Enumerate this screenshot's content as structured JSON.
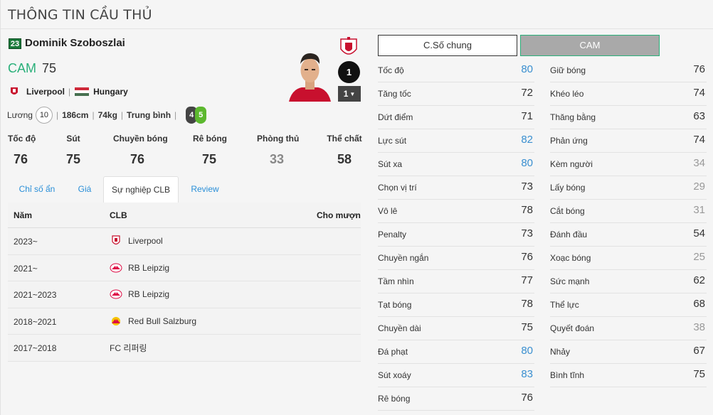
{
  "page_title": "THÔNG TIN CẦU THỦ",
  "player": {
    "number": "23",
    "name": "Dominik Szoboszlai",
    "position": "CAM",
    "overall": "75",
    "club": "Liverpool",
    "nation": "Hungary",
    "salary_label": "Lương",
    "salary": "10",
    "height": "186cm",
    "weight": "74kg",
    "body": "Trung bình",
    "weak_foot_left": "4",
    "weak_foot_right": "5",
    "rank": "1",
    "upgrade": "1"
  },
  "summary_stats": [
    {
      "label": "Tốc độ",
      "value": "76",
      "state": "normal"
    },
    {
      "label": "Sút",
      "value": "75",
      "state": "normal"
    },
    {
      "label": "Chuyền bóng",
      "value": "76",
      "state": "normal"
    },
    {
      "label": "Rê bóng",
      "value": "75",
      "state": "normal"
    },
    {
      "label": "Phòng thủ",
      "value": "33",
      "state": "grey"
    },
    {
      "label": "Thể chất",
      "value": "58",
      "state": "normal"
    }
  ],
  "tabs": [
    "Chỉ số ẩn",
    "Giá",
    "Sự nghiệp CLB",
    "Review"
  ],
  "career_table": {
    "headers": {
      "year": "Năm",
      "club": "CLB",
      "loan": "Cho mượn"
    },
    "rows": [
      {
        "year": "2023~",
        "club": "Liverpool",
        "icon": "liverpool-crest-icon"
      },
      {
        "year": "2021~",
        "club": "RB Leipzig",
        "icon": "rb-leipzig-crest-icon"
      },
      {
        "year": "2021~2023",
        "club": "RB Leipzig",
        "icon": "rb-leipzig-crest-icon"
      },
      {
        "year": "2018~2021",
        "club": "Red Bull Salzburg",
        "icon": "rb-salzburg-crest-icon"
      },
      {
        "year": "2017~2018",
        "club": "FC 리퍼링",
        "icon": ""
      }
    ]
  },
  "mode_buttons": {
    "general": "C.Số chung",
    "position": "CAM"
  },
  "attributes_left": [
    {
      "name": "Tốc độ",
      "value": "80",
      "state": "blue"
    },
    {
      "name": "Tăng tốc",
      "value": "72",
      "state": "normal"
    },
    {
      "name": "Dứt điểm",
      "value": "71",
      "state": "normal"
    },
    {
      "name": "Lực sút",
      "value": "82",
      "state": "blue"
    },
    {
      "name": "Sút xa",
      "value": "80",
      "state": "blue"
    },
    {
      "name": "Chọn vị trí",
      "value": "73",
      "state": "normal"
    },
    {
      "name": "Vô lê",
      "value": "78",
      "state": "normal"
    },
    {
      "name": "Penalty",
      "value": "73",
      "state": "normal"
    },
    {
      "name": "Chuyền ngắn",
      "value": "76",
      "state": "normal"
    },
    {
      "name": "Tầm nhìn",
      "value": "77",
      "state": "normal"
    },
    {
      "name": "Tạt bóng",
      "value": "78",
      "state": "normal"
    },
    {
      "name": "Chuyền dài",
      "value": "75",
      "state": "normal"
    },
    {
      "name": "Đá phạt",
      "value": "80",
      "state": "blue"
    },
    {
      "name": "Sút xoáy",
      "value": "83",
      "state": "blue"
    },
    {
      "name": "Rê bóng",
      "value": "76",
      "state": "normal"
    }
  ],
  "attributes_right": [
    {
      "name": "Giữ bóng",
      "value": "76",
      "state": "normal"
    },
    {
      "name": "Khéo léo",
      "value": "74",
      "state": "normal"
    },
    {
      "name": "Thăng bằng",
      "value": "63",
      "state": "normal"
    },
    {
      "name": "Phản ứng",
      "value": "74",
      "state": "normal"
    },
    {
      "name": "Kèm người",
      "value": "34",
      "state": "grey"
    },
    {
      "name": "Lấy bóng",
      "value": "29",
      "state": "grey"
    },
    {
      "name": "Cắt bóng",
      "value": "31",
      "state": "grey"
    },
    {
      "name": "Đánh đầu",
      "value": "54",
      "state": "normal"
    },
    {
      "name": "Xoạc bóng",
      "value": "25",
      "state": "grey"
    },
    {
      "name": "Sức mạnh",
      "value": "62",
      "state": "normal"
    },
    {
      "name": "Thể lực",
      "value": "68",
      "state": "normal"
    },
    {
      "name": "Quyết đoán",
      "value": "38",
      "state": "grey"
    },
    {
      "name": "Nhảy",
      "value": "67",
      "state": "normal"
    },
    {
      "name": "Bình tĩnh",
      "value": "75",
      "state": "normal"
    }
  ],
  "colors": {
    "accent_green": "#2ab07a",
    "stat_blue": "#3a8fd0",
    "stat_grey": "#999999"
  }
}
